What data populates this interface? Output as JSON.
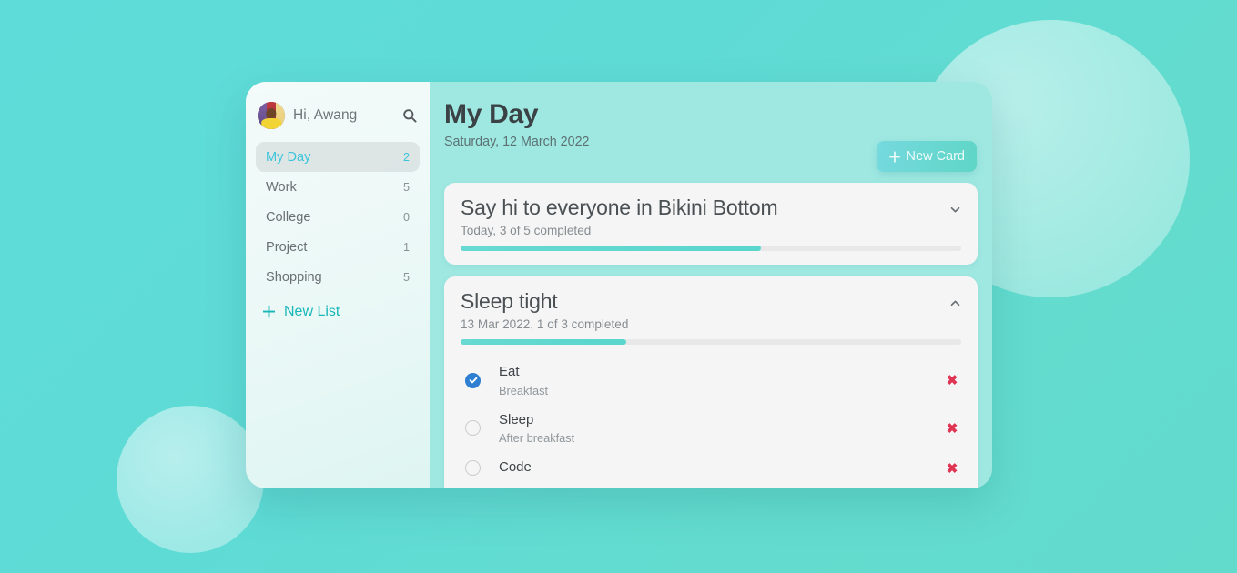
{
  "sidebar": {
    "profile": {
      "greeting": "Hi, Awang",
      "avatar_name": "user-avatar"
    },
    "search_icon": "search-icon",
    "items": [
      {
        "label": "My Day",
        "count": "2",
        "active": true
      },
      {
        "label": "Work",
        "count": "5",
        "active": false
      },
      {
        "label": "College",
        "count": "0",
        "active": false
      },
      {
        "label": "Project",
        "count": "1",
        "active": false
      },
      {
        "label": "Shopping",
        "count": "5",
        "active": false
      }
    ],
    "new_list": {
      "label": "New List",
      "plus": "＋"
    }
  },
  "main": {
    "title": "My Day",
    "subtitle": "Saturday, 12 March 2022",
    "new_card_button": {
      "label": "New Card",
      "plus": "＋"
    },
    "cards": [
      {
        "title": "Say hi to everyone in Bikini Bottom",
        "subtitle": "Today, 3 of 5 completed",
        "progress_percent": 60,
        "expanded": false,
        "chevron": "chevron-down-icon",
        "tasks": []
      },
      {
        "title": "Sleep tight",
        "subtitle": "13 Mar 2022, 1 of 3 completed",
        "progress_percent": 33,
        "expanded": true,
        "chevron": "chevron-up-icon",
        "tasks": [
          {
            "title": "Eat",
            "note": "Breakfast",
            "checked": true
          },
          {
            "title": "Sleep",
            "note": "After breakfast",
            "checked": false
          },
          {
            "title": "Code",
            "note": "",
            "checked": false
          }
        ]
      }
    ]
  },
  "colors": {
    "background_start": "#5EDCD9",
    "background_end": "#62DBCD",
    "sidebar_bg": "#EAF8F6",
    "main_bg": "#9FE8E2",
    "card_bg": "#F5F5F5",
    "accent_cyan": "#3CC5DA",
    "accent_teal": "#18B7B7",
    "progress_fill": "#5FD6CE",
    "delete_red": "#E03552",
    "checkbox_blue": "#2E7FD1"
  }
}
